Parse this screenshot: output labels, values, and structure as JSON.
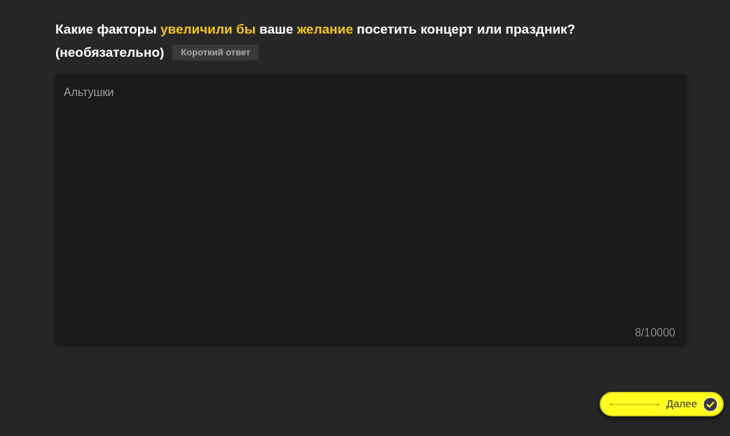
{
  "question": {
    "segments": [
      {
        "text": "Какие факторы ",
        "highlight": false
      },
      {
        "text": "увеличили бы",
        "highlight": true
      },
      {
        "text": " ваше ",
        "highlight": false
      },
      {
        "text": "желание",
        "highlight": true
      },
      {
        "text": " посетить концерт или праздник?",
        "highlight": false
      }
    ],
    "note": "(необязательно)",
    "badge": "Короткий ответ"
  },
  "answer": {
    "value": "Альтушки",
    "counter": "8/10000"
  },
  "next_button": {
    "label": "Далее"
  }
}
